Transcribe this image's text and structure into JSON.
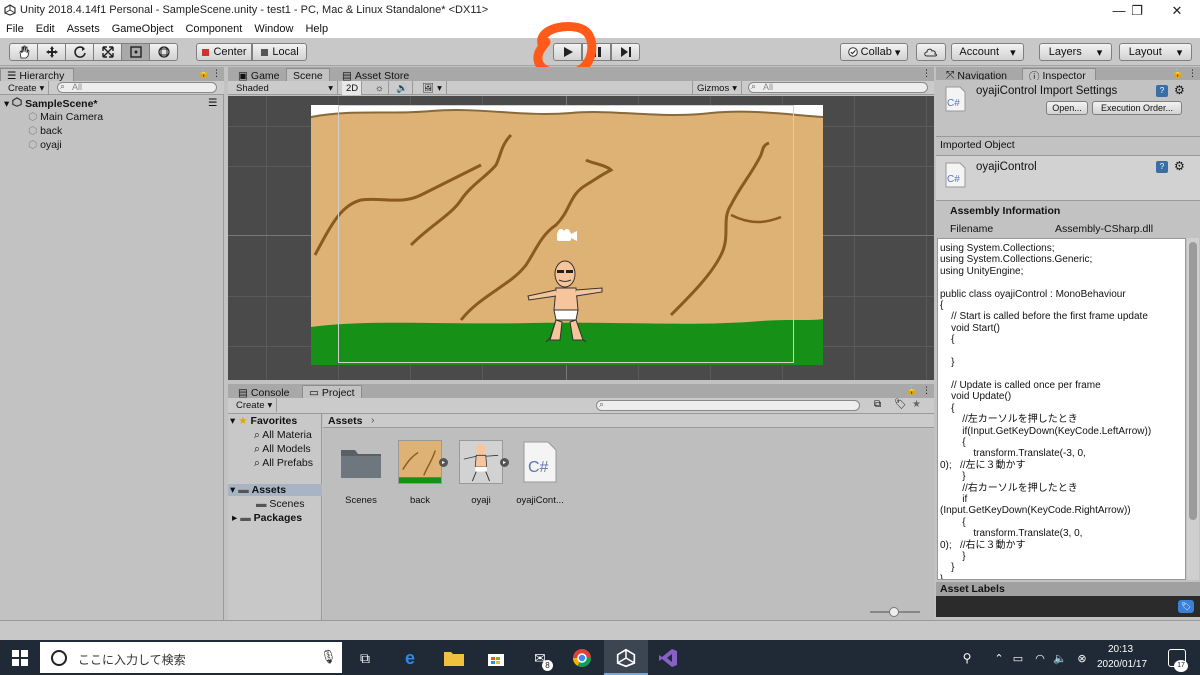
{
  "window": {
    "title": "Unity 2018.4.14f1 Personal - SampleScene.unity - test1 - PC, Mac & Linux Standalone* <DX11>",
    "minimize": "—",
    "maximize": "❐",
    "close": "✕"
  },
  "menu": [
    "File",
    "Edit",
    "Assets",
    "GameObject",
    "Component",
    "Window",
    "Help"
  ],
  "toolbar": {
    "tools": [
      "hand-tool",
      "move-tool",
      "rotate-tool",
      "scale-tool",
      "rect-tool",
      "transform-tool"
    ],
    "pivot_center": "Center",
    "pivot_local": "Local",
    "collab": "Collab",
    "account": "Account",
    "layers": "Layers",
    "layout": "Layout",
    "play_highlight_color": "#ff5a1a"
  },
  "hierarchy": {
    "tab": "Hierarchy",
    "create": "Create",
    "search_placeholder": "All",
    "scene": "SampleScene*",
    "items": [
      "Main Camera",
      "back",
      "oyaji"
    ]
  },
  "center_tabs": {
    "game": "Game",
    "scene": "Scene",
    "asset_store": "Asset Store"
  },
  "scene_toolbar": {
    "shading": "Shaded",
    "mode_2d": "2D",
    "gizmos": "Gizmos",
    "search_placeholder": "All"
  },
  "bottom_tabs": {
    "console": "Console",
    "project": "Project"
  },
  "project": {
    "create": "Create",
    "favorites": "Favorites",
    "favorite_items": [
      "All Materia",
      "All Models",
      "All Prefabs"
    ],
    "assets_root": "Assets",
    "asset_children": [
      "Scenes"
    ],
    "packages": "Packages",
    "breadcrumb": "Assets",
    "assets": [
      {
        "name": "Scenes",
        "kind": "folder"
      },
      {
        "name": "back",
        "kind": "sprite"
      },
      {
        "name": "oyaji",
        "kind": "sprite"
      },
      {
        "name": "oyajiCont...",
        "kind": "script"
      }
    ]
  },
  "inspector": {
    "tab_navigation": "Navigation",
    "tab_inspector": "Inspector",
    "header": "oyajiControl Import Settings",
    "open_btn": "Open...",
    "exec_btn": "Execution Order...",
    "imported_object": "Imported Object",
    "object_name": "oyajiControl",
    "assembly_info": "Assembly Information",
    "filename_label": "Filename",
    "filename_value": "Assembly-CSharp.dll",
    "code": "using System.Collections;\nusing System.Collections.Generic;\nusing UnityEngine;\n\npublic class oyajiControl : MonoBehaviour\n{\n    // Start is called before the first frame update\n    void Start()\n    {\n\n    }\n\n    // Update is called once per frame\n    void Update()\n    {\n        //左カーソルを押したとき\n        if(Input.GetKeyDown(KeyCode.LeftArrow))\n        {\n            transform.Translate(-3, 0,\n0);   //左に３動かす\n        }\n        //右カーソルを押したとき\n        if\n(Input.GetKeyDown(KeyCode.RightArrow))\n        {\n            transform.Translate(3, 0,\n0);   //右に３動かす\n        }\n    }\n}",
    "asset_labels": "Asset Labels"
  },
  "taskbar": {
    "search_placeholder": "ここに入力して検索",
    "time": "20:13",
    "date": "2020/01/17",
    "mail_badge": "8",
    "notif_count": "17"
  }
}
